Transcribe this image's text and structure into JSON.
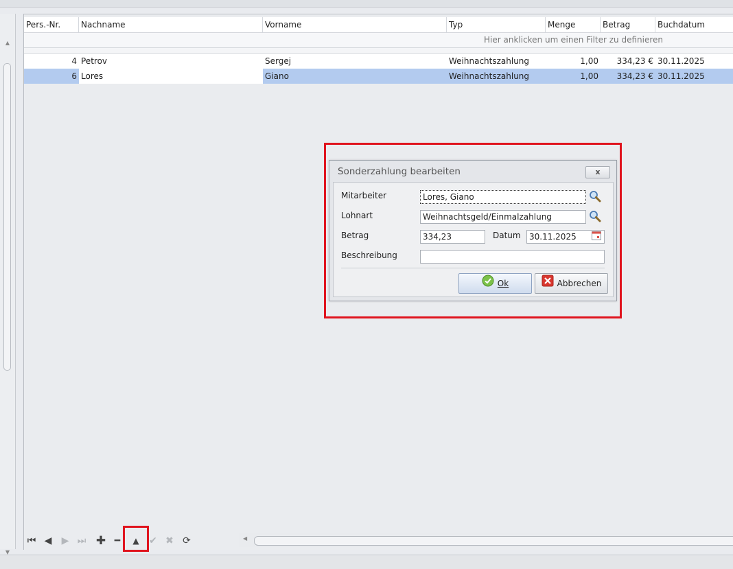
{
  "grid": {
    "columns": [
      "Pers.-Nr.",
      "Nachname",
      "Vorname",
      "Typ",
      "Menge",
      "Betrag",
      "Buchdatum"
    ],
    "filter_hint": "Hier anklicken um einen Filter zu definieren",
    "rows": [
      {
        "nr": "4",
        "nachname": "Petrov",
        "vorname": "Sergej",
        "typ": "Weihnachtszahlung",
        "menge": "1,00",
        "betrag": "334,23 €",
        "datum": "30.11.2025"
      },
      {
        "nr": "6",
        "nachname": "Lores",
        "vorname": "Giano",
        "typ": "Weihnachtszahlung",
        "menge": "1,00",
        "betrag": "334,23 €",
        "datum": "30.11.2025"
      }
    ],
    "selected_row": 1
  },
  "dialog": {
    "title": "Sonderzahlung bearbeiten",
    "close_label": "x",
    "fields": {
      "mitarbeiter_label": "Mitarbeiter",
      "mitarbeiter_value": "Lores, Giano",
      "lohnart_label": "Lohnart",
      "lohnart_value": "Weihnachtsgeld/Einmalzahlung",
      "betrag_label": "Betrag",
      "betrag_value": "334,23",
      "datum_label": "Datum",
      "datum_value": "30.11.2025",
      "beschreibung_label": "Beschreibung",
      "beschreibung_value": ""
    },
    "ok_label": "Ok",
    "cancel_label": "Abbrechen"
  },
  "colors": {
    "selection": "#b3cbef",
    "highlight_border": "#e0141e"
  },
  "navigator_icons": [
    "first-icon",
    "prior-icon",
    "next-icon",
    "last-icon",
    "insert-icon",
    "delete-icon",
    "edit-icon",
    "post-icon",
    "cancel-icon",
    "refresh-icon"
  ]
}
